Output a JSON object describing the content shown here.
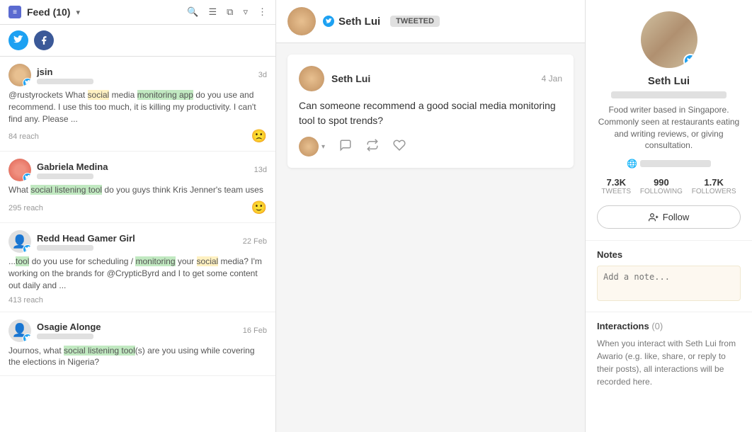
{
  "left": {
    "header": {
      "title": "Feed (10)",
      "chevron": "▾",
      "icons": [
        "search",
        "filter-sort",
        "layers",
        "filter",
        "more"
      ]
    },
    "socialIcons": [
      "twitter",
      "facebook"
    ],
    "items": [
      {
        "id": "jsin",
        "username": "jsin",
        "time": "3d",
        "snippet": "@rustyrockets What social media monitoring app do you use and recommend. I use this too much, it is killing my productivity. I can't find any. Please ...",
        "reach": "84 reach",
        "sentiment": "negative"
      },
      {
        "id": "gabriela",
        "username": "Gabriela Medina",
        "time": "13d",
        "snippet": "What social listening tool do you guys think Kris Jenner's team uses",
        "reach": "295 reach",
        "sentiment": "positive"
      },
      {
        "id": "redd",
        "username": "Redd Head Gamer Girl",
        "time": "22 Feb",
        "snippet": "...tool do you use for scheduling / monitoring your social media? I'm working on the brands for @CrypticByrd and I to get some content out daily and ...",
        "reach": "413 reach",
        "sentiment": "none"
      },
      {
        "id": "osagie",
        "username": "Osagie Alonge",
        "time": "16 Feb",
        "snippet": "Journos, what social listening tool(s) are you using while covering the elections in Nigeria?",
        "reach": "",
        "sentiment": "none"
      }
    ]
  },
  "middle": {
    "header": {
      "username": "Seth Lui",
      "badge": "TWEETED"
    },
    "tweet": {
      "username": "Seth Lui",
      "date": "4 Jan",
      "text": "Can someone recommend a good social media monitoring tool to spot trends?"
    }
  },
  "right": {
    "profile": {
      "name": "Seth Lui",
      "bio": "Food writer based in Singapore. Commonly seen at restaurants eating and writing reviews, or giving consultation.",
      "stats": {
        "tweets_label": "TWEETS",
        "tweets_value": "7.3K",
        "following_label": "FOLLOWING",
        "following_value": "990",
        "followers_label": "FOLLOWERS",
        "followers_value": "1.7K"
      },
      "follow_label": "Follow"
    },
    "notes": {
      "title": "Notes",
      "placeholder": "Add a note..."
    },
    "interactions": {
      "title": "Interactions",
      "count": "(0)",
      "text": "When you interact with Seth Lui from Awario (e.g. like, share, or reply to their posts), all interactions will be recorded here."
    }
  }
}
